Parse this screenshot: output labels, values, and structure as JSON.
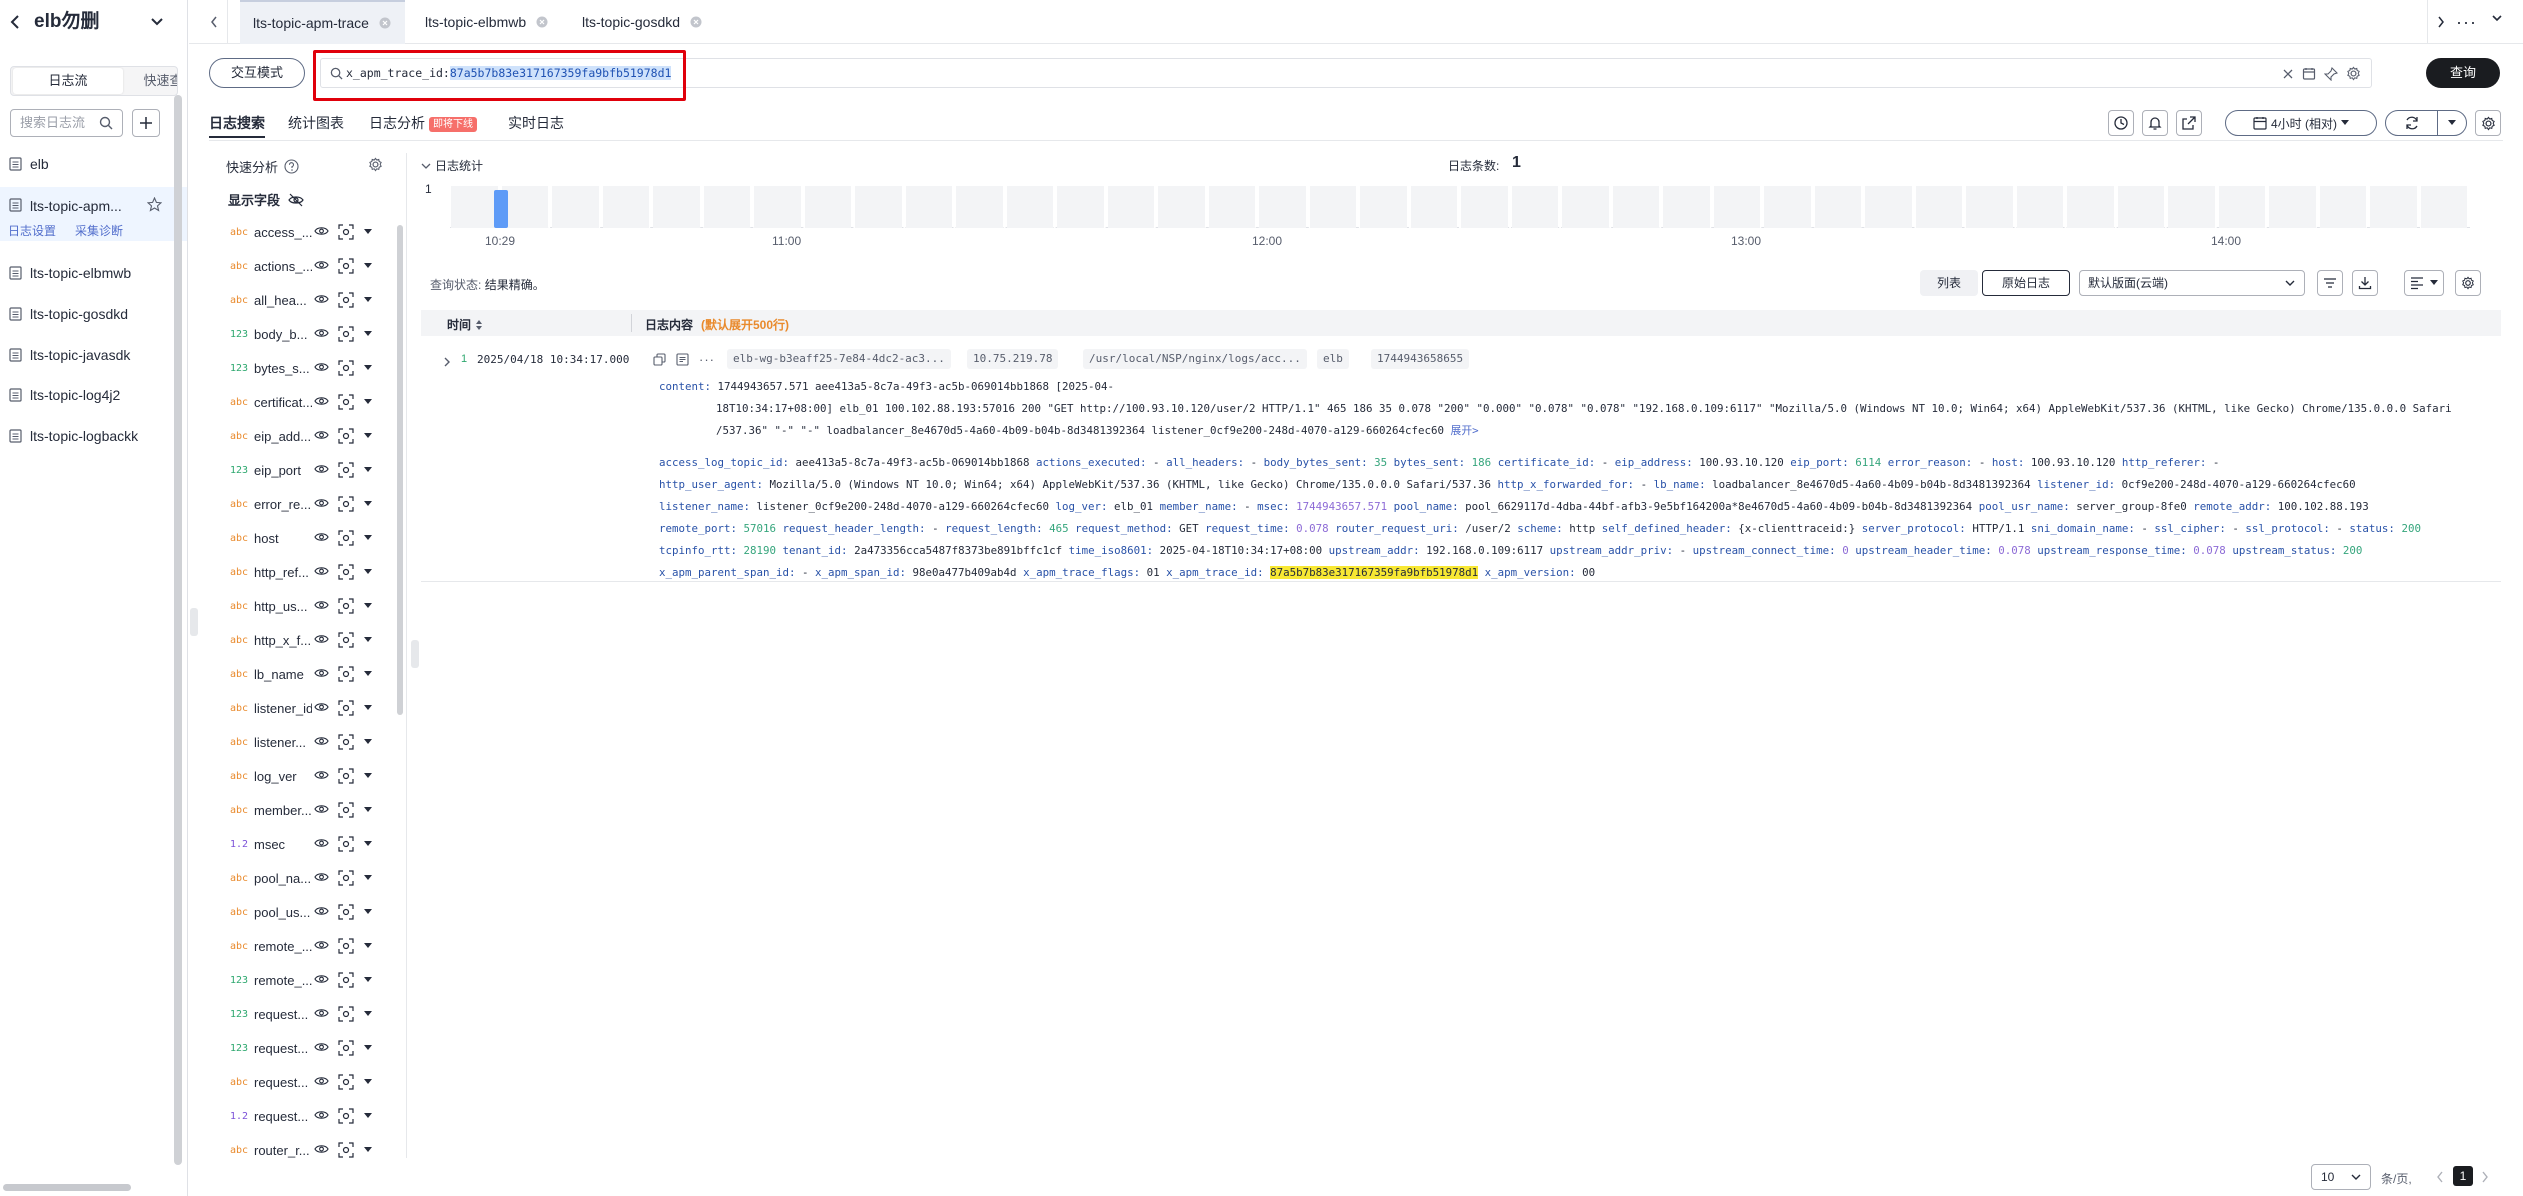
{
  "sidebar": {
    "title": "elb勿删",
    "tabs": [
      "日志流",
      "快速查"
    ],
    "search_placeholder": "搜索日志流",
    "items": [
      {
        "label": "elb"
      },
      {
        "label": "lts-topic-apm..."
      },
      {
        "label": "lts-topic-elbmwb"
      },
      {
        "label": "lts-topic-gosdkd"
      },
      {
        "label": "lts-topic-javasdk"
      },
      {
        "label": "lts-topic-log4j2"
      },
      {
        "label": "lts-topic-logbackk"
      }
    ],
    "active_sub": [
      "日志设置",
      "采集诊断"
    ]
  },
  "tabs": [
    {
      "label": "lts-topic-apm-trace"
    },
    {
      "label": "lts-topic-elbmwb"
    },
    {
      "label": "lts-topic-gosdkd"
    }
  ],
  "query": {
    "mode_label": "交互模式",
    "key": "x_apm_trace_id:",
    "value": "87a5b7b83e317167359fa9bfb51978d1",
    "run_label": "查询"
  },
  "subtabs": {
    "search": "日志搜索",
    "chart": "统计图表",
    "analysis": "日志分析",
    "analysis_badge": "即将下线",
    "realtime": "实时日志"
  },
  "time_range": "4小时 (相对)",
  "fields_panel": {
    "quick_label": "快速分析",
    "show_fields_label": "显示字段",
    "fields": [
      {
        "type": "abc",
        "name": "access_..."
      },
      {
        "type": "abc",
        "name": "actions_..."
      },
      {
        "type": "abc",
        "name": "all_hea..."
      },
      {
        "type": "123",
        "name": "body_b..."
      },
      {
        "type": "123",
        "name": "bytes_s..."
      },
      {
        "type": "abc",
        "name": "certificat..."
      },
      {
        "type": "abc",
        "name": "eip_add..."
      },
      {
        "type": "123",
        "name": "eip_port"
      },
      {
        "type": "abc",
        "name": "error_re..."
      },
      {
        "type": "abc",
        "name": "host"
      },
      {
        "type": "abc",
        "name": "http_ref..."
      },
      {
        "type": "abc",
        "name": "http_us..."
      },
      {
        "type": "abc",
        "name": "http_x_f..."
      },
      {
        "type": "abc",
        "name": "lb_name"
      },
      {
        "type": "abc",
        "name": "listener_id"
      },
      {
        "type": "abc",
        "name": "listener..."
      },
      {
        "type": "abc",
        "name": "log_ver"
      },
      {
        "type": "abc",
        "name": "member..."
      },
      {
        "type": "1.2",
        "name": "msec"
      },
      {
        "type": "abc",
        "name": "pool_na..."
      },
      {
        "type": "abc",
        "name": "pool_us..."
      },
      {
        "type": "abc",
        "name": "remote_..."
      },
      {
        "type": "123",
        "name": "remote_..."
      },
      {
        "type": "123",
        "name": "request..."
      },
      {
        "type": "123",
        "name": "request..."
      },
      {
        "type": "abc",
        "name": "request..."
      },
      {
        "type": "1.2",
        "name": "request..."
      },
      {
        "type": "abc",
        "name": "router_r..."
      }
    ]
  },
  "histogram": {
    "label": "日志统计",
    "count_label": "日志条数:",
    "count": "1",
    "y_max": "1",
    "x_ticks": [
      "10:29",
      "11:00",
      "12:00",
      "13:00",
      "14:00"
    ],
    "bucket_value": 1
  },
  "query_status": {
    "label": "查询状态:",
    "value": "结果精确。"
  },
  "view": {
    "list_label": "列表",
    "raw_label": "原始日志",
    "layout": "默认版面(云端)"
  },
  "table": {
    "time_header": "时间",
    "content_header": "日志内容",
    "content_note": "(默认展开500行)"
  },
  "log": {
    "index": "1",
    "time": "2025/04/18 10:34:17.000",
    "tags": [
      "elb-wg-b3eaff25-7e84-4dc2-ac3...",
      "10.75.219.78",
      "/usr/local/NSP/nginx/logs/acc...",
      "elb",
      "1744943658655"
    ],
    "content_key": "content:",
    "content_line1": "1744943657.571 aee413a5-8c7a-49f3-ac5b-069014bb1868 [2025-04-",
    "content_line2": "18T10:34:17+08:00] elb_01 100.102.88.193:57016 200 \"GET http://100.93.10.120/user/2 HTTP/1.1\" 465 186 35 0.078 \"200\" \"0.000\" \"0.078\" \"0.078\" \"192.168.0.109:6117\" \"Mozilla/5.0 (Windows NT 10.0; Win64; x64) AppleWebKit/537.36 (KHTML, like Gecko) Chrome/135.0.0.0 Safari",
    "content_line3": "/537.36\" \"-\" \"-\" loadbalancer_8e4670d5-4a60-4b09-b04b-8d3481392364 listener_0cf9e200-248d-4070-a129-660264cfec60",
    "expand_label": "展开>",
    "lines": [
      [
        [
          "access_log_topic_id:",
          "k"
        ],
        [
          " aee413a5-8c7a-49f3-ac5b-069014bb1868  ",
          ""
        ],
        [
          "actions_executed:",
          "k"
        ],
        [
          " -  ",
          ""
        ],
        [
          "all_headers:",
          "k"
        ],
        [
          " -  ",
          ""
        ],
        [
          "body_bytes_sent:",
          "k"
        ],
        [
          " 35",
          "gv"
        ],
        [
          "  ",
          ""
        ],
        [
          "bytes_sent:",
          "k"
        ],
        [
          " 186",
          "gv"
        ],
        [
          "  ",
          ""
        ],
        [
          "certificate_id:",
          "k"
        ],
        [
          " -  ",
          ""
        ],
        [
          "eip_address:",
          "k"
        ],
        [
          " 100.93.10.120  ",
          ""
        ],
        [
          "eip_port:",
          "k"
        ],
        [
          " 6114",
          "gv"
        ],
        [
          "  ",
          ""
        ],
        [
          "error_reason:",
          "k"
        ],
        [
          " -  ",
          ""
        ],
        [
          "host:",
          "k"
        ],
        [
          " 100.93.10.120  ",
          ""
        ],
        [
          "http_referer:",
          "k"
        ],
        [
          " -",
          ""
        ]
      ],
      [
        [
          "http_user_agent:",
          "k"
        ],
        [
          " Mozilla/5.0 (Windows NT 10.0; Win64; x64) AppleWebKit/537.36 (KHTML, like Gecko) Chrome/135.0.0.0 Safari/537.36  ",
          ""
        ],
        [
          "http_x_forwarded_for:",
          "k"
        ],
        [
          " -  ",
          ""
        ],
        [
          "lb_name:",
          "k"
        ],
        [
          " loadbalancer_8e4670d5-4a60-4b09-b04b-8d3481392364  ",
          ""
        ],
        [
          "listener_id:",
          "k"
        ],
        [
          " 0cf9e200-248d-4070-a129-660264cfec60",
          ""
        ]
      ],
      [
        [
          "listener_name:",
          "k"
        ],
        [
          " listener_0cf9e200-248d-4070-a129-660264cfec60  ",
          ""
        ],
        [
          "log_ver:",
          "k"
        ],
        [
          " elb_01  ",
          ""
        ],
        [
          "member_name:",
          "k"
        ],
        [
          " -  ",
          ""
        ],
        [
          "msec:",
          "k"
        ],
        [
          " 1744943657.571",
          "nv"
        ],
        [
          "  ",
          ""
        ],
        [
          "pool_name:",
          "k"
        ],
        [
          " pool_6629117d-4dba-44bf-afb3-9e5bf164200a*8e4670d5-4a60-4b09-b04b-8d3481392364  ",
          ""
        ],
        [
          "pool_usr_name:",
          "k"
        ],
        [
          " server_group-8fe0  ",
          ""
        ],
        [
          "remote_addr:",
          "k"
        ],
        [
          " 100.102.88.193",
          ""
        ]
      ],
      [
        [
          "remote_port:",
          "k"
        ],
        [
          " 57016",
          "gv"
        ],
        [
          "  ",
          ""
        ],
        [
          "request_header_length:",
          "k"
        ],
        [
          " -  ",
          ""
        ],
        [
          "request_length:",
          "k"
        ],
        [
          " 465",
          "gv"
        ],
        [
          "  ",
          ""
        ],
        [
          "request_method:",
          "k"
        ],
        [
          " GET  ",
          ""
        ],
        [
          "request_time:",
          "k"
        ],
        [
          " 0.078",
          "nv"
        ],
        [
          "  ",
          ""
        ],
        [
          "router_request_uri:",
          "k"
        ],
        [
          " /user/2  ",
          ""
        ],
        [
          "scheme:",
          "k"
        ],
        [
          " http  ",
          ""
        ],
        [
          "self_defined_header:",
          "k"
        ],
        [
          " {x-clienttraceid:}  ",
          ""
        ],
        [
          "server_protocol:",
          "k"
        ],
        [
          " HTTP/1.1  ",
          ""
        ],
        [
          "sni_domain_name:",
          "k"
        ],
        [
          " -  ",
          ""
        ],
        [
          "ssl_cipher:",
          "k"
        ],
        [
          " -  ",
          ""
        ],
        [
          "ssl_protocol:",
          "k"
        ],
        [
          " -  ",
          ""
        ],
        [
          "status:",
          "k"
        ],
        [
          " 200",
          "gv"
        ]
      ],
      [
        [
          "tcpinfo_rtt:",
          "k"
        ],
        [
          " 28190",
          "gv"
        ],
        [
          "  ",
          ""
        ],
        [
          "tenant_id:",
          "k"
        ],
        [
          " 2a473356cca5487f8373be891bffc1cf  ",
          ""
        ],
        [
          "time_iso8601:",
          "k"
        ],
        [
          " 2025-04-18T10:34:17+08:00  ",
          ""
        ],
        [
          "upstream_addr:",
          "k"
        ],
        [
          " 192.168.0.109:6117  ",
          ""
        ],
        [
          "upstream_addr_priv:",
          "k"
        ],
        [
          " -  ",
          ""
        ],
        [
          "upstream_connect_time:",
          "k"
        ],
        [
          " 0",
          "nv"
        ],
        [
          "  ",
          ""
        ],
        [
          "upstream_header_time:",
          "k"
        ],
        [
          " 0.078",
          "nv"
        ],
        [
          "  ",
          ""
        ],
        [
          "upstream_response_time:",
          "k"
        ],
        [
          " 0.078",
          "nv"
        ],
        [
          "  ",
          ""
        ],
        [
          "upstream_status:",
          "k"
        ],
        [
          " 200",
          "gv"
        ]
      ],
      [
        [
          "x_apm_parent_span_id:",
          "k"
        ],
        [
          " -  ",
          ""
        ],
        [
          "x_apm_span_id:",
          "k"
        ],
        [
          " 98e0a477b409ab4d  ",
          ""
        ],
        [
          "x_apm_trace_flags:",
          "k"
        ],
        [
          " 01  ",
          ""
        ],
        [
          "x_apm_trace_id:",
          "k"
        ],
        [
          " ",
          ""
        ],
        [
          "87a5b7b83e317167359fa9bfb51978d1",
          "hl"
        ],
        [
          "  ",
          ""
        ],
        [
          "x_apm_version:",
          "k"
        ],
        [
          " 00",
          ""
        ]
      ]
    ]
  },
  "pagination": {
    "page_size": "10",
    "unit": "条/页,",
    "current": "1"
  },
  "colors": {
    "accent": "#526ecc",
    "highlight": "#f8e833",
    "query_border": "#e0000b",
    "bar": "#5e9bf7"
  }
}
